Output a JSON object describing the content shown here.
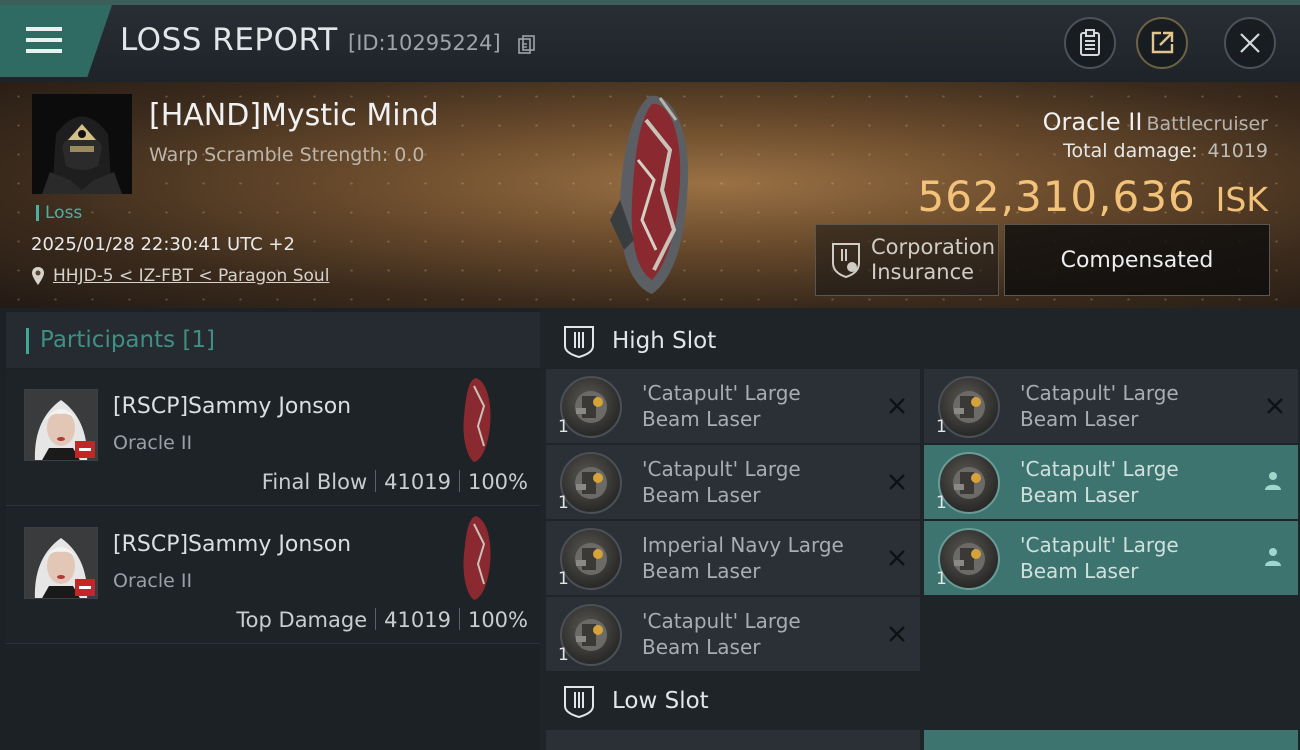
{
  "header": {
    "title": "LOSS REPORT",
    "report_id": "[ID:10295224]"
  },
  "banner": {
    "victim_name": "[HAND]Mystic Mind",
    "warp_scramble": "Warp Scramble Strength: 0.0",
    "result_tag": "Loss",
    "datetime": "2025/01/28 22:30:41 UTC +2",
    "location": "HHJD-5 < IZ-FBT < Paragon Soul",
    "ship_name": "Oracle II",
    "ship_class": "Battlecruiser",
    "total_damage_label": "Total damage:",
    "total_damage": "41019",
    "isk_value": "562,310,636",
    "isk_currency": "ISK",
    "insurance_label_line1": "Corporation",
    "insurance_label_line2": "Insurance",
    "insurance_status": "Compensated"
  },
  "participants": {
    "title": "Participants [1]",
    "items": [
      {
        "name": "[RSCP]Sammy Jonson",
        "ship": "Oracle II",
        "role": "Final Blow",
        "damage": "41019",
        "percent": "100%"
      },
      {
        "name": "[RSCP]Sammy Jonson",
        "ship": "Oracle II",
        "role": "Top Damage",
        "damage": "41019",
        "percent": "100%"
      }
    ]
  },
  "high_slot": {
    "title": "High Slot",
    "modules": [
      {
        "line1": "'Catapult' Large",
        "line2": "Beam Laser",
        "qty": "1",
        "action": "close"
      },
      {
        "line1": "'Catapult' Large",
        "line2": "Beam Laser",
        "qty": "1",
        "action": "close"
      },
      {
        "line1": "'Catapult' Large",
        "line2": "Beam Laser",
        "qty": "1",
        "action": "close"
      },
      {
        "line1": "'Catapult' Large",
        "line2": "Beam Laser",
        "qty": "1",
        "action": "person"
      },
      {
        "line1": "Imperial Navy Large",
        "line2": "Beam Laser",
        "qty": "1",
        "action": "close"
      },
      {
        "line1": "'Catapult' Large",
        "line2": "Beam Laser",
        "qty": "1",
        "action": "person"
      },
      {
        "line1": "'Catapult' Large",
        "line2": "Beam Laser",
        "qty": "1",
        "action": "close"
      }
    ]
  },
  "low_slot": {
    "title": "Low Slot"
  },
  "colors": {
    "accent_teal": "#3fa898",
    "isk_gold": "#f2c27a",
    "dropped_highlight": "#3e7470",
    "loss_badge_red": "#c42626"
  },
  "icons": [
    "menu-icon",
    "copy-icon",
    "clipboard-icon",
    "share-icon",
    "close-icon",
    "location-pin-icon",
    "shield-icon",
    "laser-module-icon",
    "person-icon"
  ]
}
